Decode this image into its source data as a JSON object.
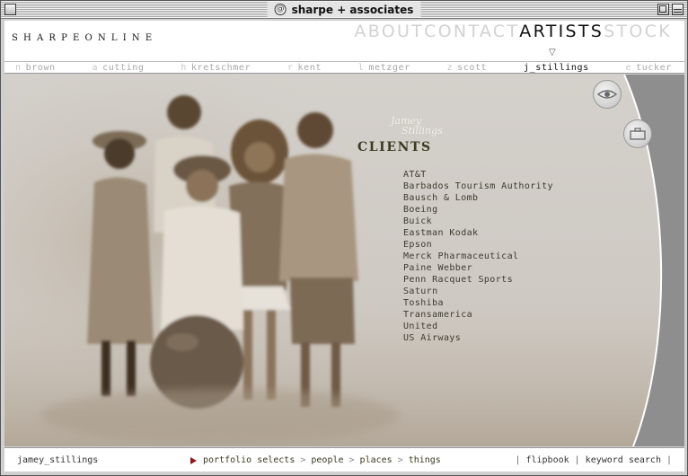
{
  "window": {
    "title": "sharpe + associates",
    "globe_glyph": "@"
  },
  "header": {
    "logo": "SHARPEONLINE",
    "nav": [
      {
        "label": "ABOUT",
        "active": false
      },
      {
        "label": "CONTACT",
        "active": false
      },
      {
        "label": "ARTISTS",
        "active": true
      },
      {
        "label": "STOCK",
        "active": false
      }
    ],
    "nav_marker": "▽"
  },
  "artists": [
    {
      "initial": "n",
      "name": "brown",
      "active": false
    },
    {
      "initial": "a",
      "name": "cutting",
      "active": false
    },
    {
      "initial": "h",
      "name": "kretschmer",
      "active": false
    },
    {
      "initial": "r",
      "name": "kent",
      "active": false
    },
    {
      "initial": "l",
      "name": "metzger",
      "active": false
    },
    {
      "initial": "z",
      "name": "scott",
      "active": false
    },
    {
      "initial": "",
      "name": "j_stillings",
      "active": true
    },
    {
      "initial": "e",
      "name": "tucker",
      "active": false
    }
  ],
  "main": {
    "signature_line1": "Jamey",
    "signature_line2": "Stillings",
    "clients_title": "CLIENTS",
    "clients": [
      "AT&T",
      "Barbados Tourism Authority",
      "Bausch & Lomb",
      "Boeing",
      "Buick",
      "Eastman Kodak",
      "Epson",
      "Merck Pharmaceutical",
      "Paine Webber",
      "Penn Racquet Sports",
      "Saturn",
      "Toshiba",
      "Transamerica",
      "United",
      "US Airways"
    ],
    "icons": {
      "view": "eye-icon",
      "portfolio": "briefcase-icon"
    }
  },
  "footer": {
    "artist_name": "jamey_stillings",
    "crumbs": [
      "portfolio selects",
      "people",
      "places",
      "things"
    ],
    "crumb_separator": ">",
    "tools": [
      "flipbook",
      "keyword search"
    ],
    "tool_separator": "|"
  },
  "colors": {
    "nav_inactive": "#d2d2d2",
    "nav_active": "#111111",
    "clients_title": "#3d3a22",
    "play_icon": "#8a1a1a",
    "side_panel": "#8e8e8e"
  }
}
